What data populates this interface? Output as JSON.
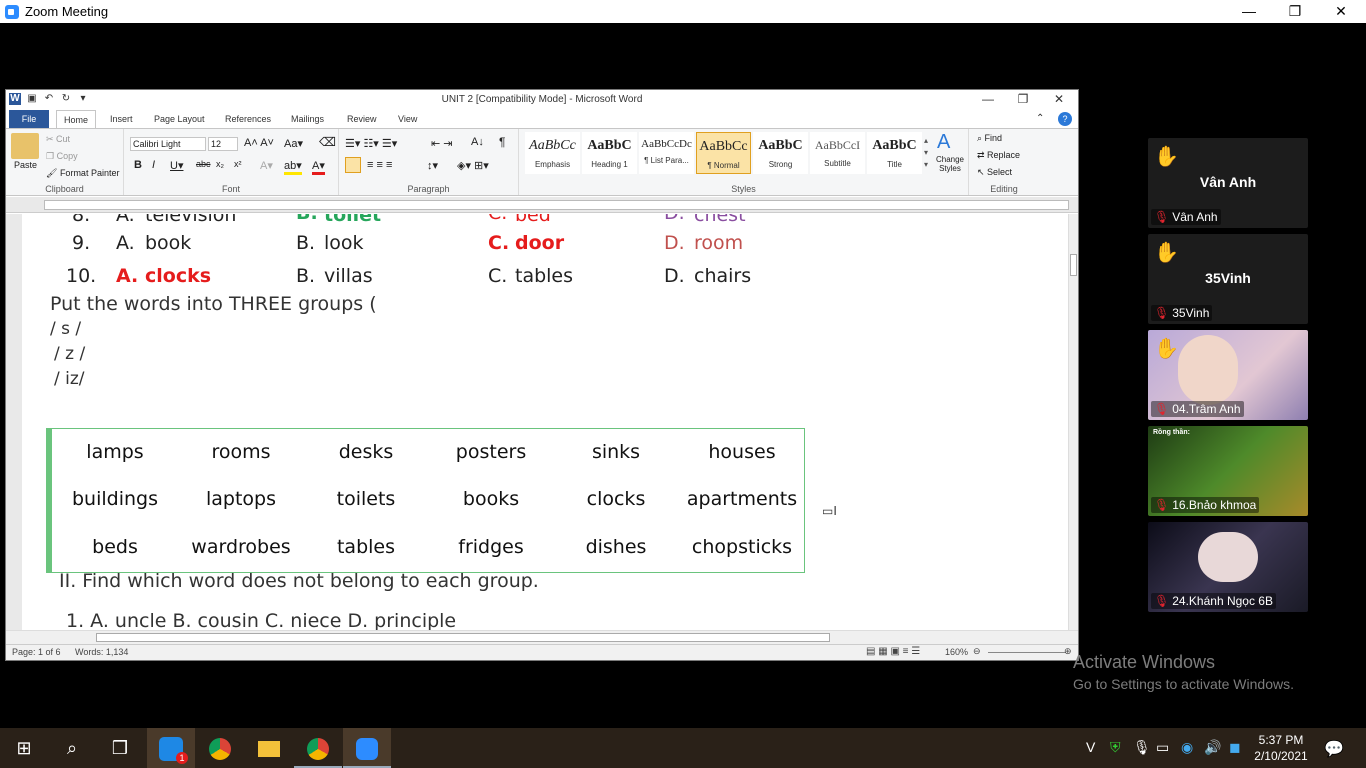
{
  "zoom": {
    "title": "Zoom Meeting",
    "minimize": "—",
    "restore": "❐",
    "close": "✕"
  },
  "word": {
    "title": "UNIT 2 [Compatibility Mode] - Microsoft Word",
    "tabs": [
      "File",
      "Home",
      "Insert",
      "Page Layout",
      "References",
      "Mailings",
      "Review",
      "View"
    ],
    "clipboard": {
      "paste": "Paste",
      "cut": "Cut",
      "copy": "Copy",
      "painter": "Format Painter",
      "label": "Clipboard"
    },
    "font": {
      "name": "Calibri Light",
      "size": "12",
      "label": "Font"
    },
    "paragraph": {
      "label": "Paragraph"
    },
    "styles": {
      "items": [
        {
          "preview": "AaBbCc",
          "name": "Emphasis"
        },
        {
          "preview": "AaBbC",
          "name": "Heading 1"
        },
        {
          "preview": "AaBbCcDc",
          "name": "¶ List Para..."
        },
        {
          "preview": "AaBbCc",
          "name": "¶ Normal"
        },
        {
          "preview": "AaBbC",
          "name": "Strong"
        },
        {
          "preview": "AaBbCcI",
          "name": "Subtitle"
        },
        {
          "preview": "AaBbC",
          "name": "Title"
        }
      ],
      "change": "Change Styles",
      "label": "Styles"
    },
    "editing": {
      "find": "Find",
      "replace": "Replace",
      "select": "Select",
      "label": "Editing"
    },
    "status": {
      "page": "Page: 1 of 6",
      "words": "Words: 1,134",
      "zoom": "160%"
    }
  },
  "doc": {
    "row8": {
      "num": "8.",
      "a": "A.",
      "aw": "television",
      "b": "B.",
      "bw": "toilet",
      "c": "C.",
      "cw": "bed",
      "d": "D.",
      "dw": "chest"
    },
    "row9": {
      "num": "9.",
      "a": "A.",
      "aw": "book",
      "b": "B.",
      "bw": "look",
      "c": "C.",
      "cw": "door",
      "d": "D.",
      "dw": "room"
    },
    "row10": {
      "num": "10.",
      "a": "A.",
      "aw": "clocks",
      "b": "B.",
      "bw": "villas",
      "c": "C.",
      "cw": "tables",
      "d": "D.",
      "dw": "chairs"
    },
    "instruction": "Put the words into THREE groups (",
    "g1": "/ s /",
    "g2": "/ z /",
    "g3": "/ iz/",
    "table": [
      [
        "lamps",
        "rooms",
        "desks",
        "posters",
        "sinks",
        "houses"
      ],
      [
        "buildings",
        "laptops",
        "toilets",
        "books",
        "clocks",
        "apartments"
      ],
      [
        "beds",
        "wardrobes",
        "tables",
        "fridges",
        "dishes",
        "chopsticks"
      ]
    ],
    "section2": "II.  Find which word does not belong to each group.",
    "cutoff": "1.    A.   uncle              B.  cousin              C.  niece              D.  principle"
  },
  "participants": [
    {
      "name": "Vân Anh",
      "label": "Vân Anh",
      "hand": true
    },
    {
      "name": "35Vinh",
      "label": "35Vinh",
      "hand": true
    },
    {
      "name": "",
      "label": "04.Trâm Anh",
      "hand": true
    },
    {
      "name": "",
      "label": "16.Bnảo khmoa",
      "hand": false,
      "caption": "Rồng thần:"
    },
    {
      "name": "",
      "label": "24.Khánh Ngọc 6B",
      "hand": false
    }
  ],
  "activate": {
    "line1": "Activate Windows",
    "line2": "Go to Settings to activate Windows."
  },
  "taskbar": {
    "time": "5:37 PM",
    "date": "2/10/2021",
    "badge": "1"
  },
  "colors": {
    "wordBlue": "#2b579a",
    "red": "#e51c1c",
    "green": "#26a65b",
    "tableBorder": "#6ac47d"
  }
}
